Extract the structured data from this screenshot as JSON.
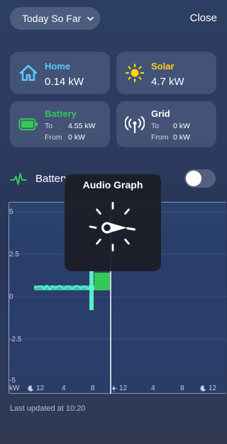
{
  "header": {
    "period_label": "Today So Far",
    "close_label": "Close"
  },
  "cards": {
    "home": {
      "title": "Home",
      "value": "0.14 kW",
      "title_color": "#5ac8fa",
      "icon": "house-icon"
    },
    "solar": {
      "title": "Solar",
      "value": "4.7 kW",
      "title_color": "#ffd60a",
      "icon": "sun-icon"
    },
    "battery": {
      "title": "Battery",
      "title_color": "#34c759",
      "icon": "battery-icon",
      "to_label": "To",
      "to_value": "4.55 kW",
      "from_label": "From",
      "from_value": "0 kW"
    },
    "grid": {
      "title": "Grid",
      "title_color": "#ffffff",
      "icon": "antenna-icon",
      "to_label": "To",
      "to_value": "0 kW",
      "from_label": "From",
      "from_value": "0 kW"
    }
  },
  "battery_row": {
    "label": "Battery",
    "icon": "waveform-icon",
    "toggle_on": false
  },
  "chart": {
    "y_ticks": [
      "5",
      "2.5",
      "0",
      "-2.5",
      "-5"
    ],
    "unit": "kW",
    "x_ticks": [
      "12",
      "4",
      "8",
      "12",
      "4",
      "8",
      "12"
    ],
    "x_tick_icons": [
      "moon-icon",
      "",
      "",
      "sun-icon",
      "",
      "",
      "moon-icon"
    ],
    "series_color": "#34c759"
  },
  "popup": {
    "title": "Audio Graph",
    "icon": "spinner-icon"
  },
  "footer": {
    "updated": "Last updated at 10:20"
  }
}
